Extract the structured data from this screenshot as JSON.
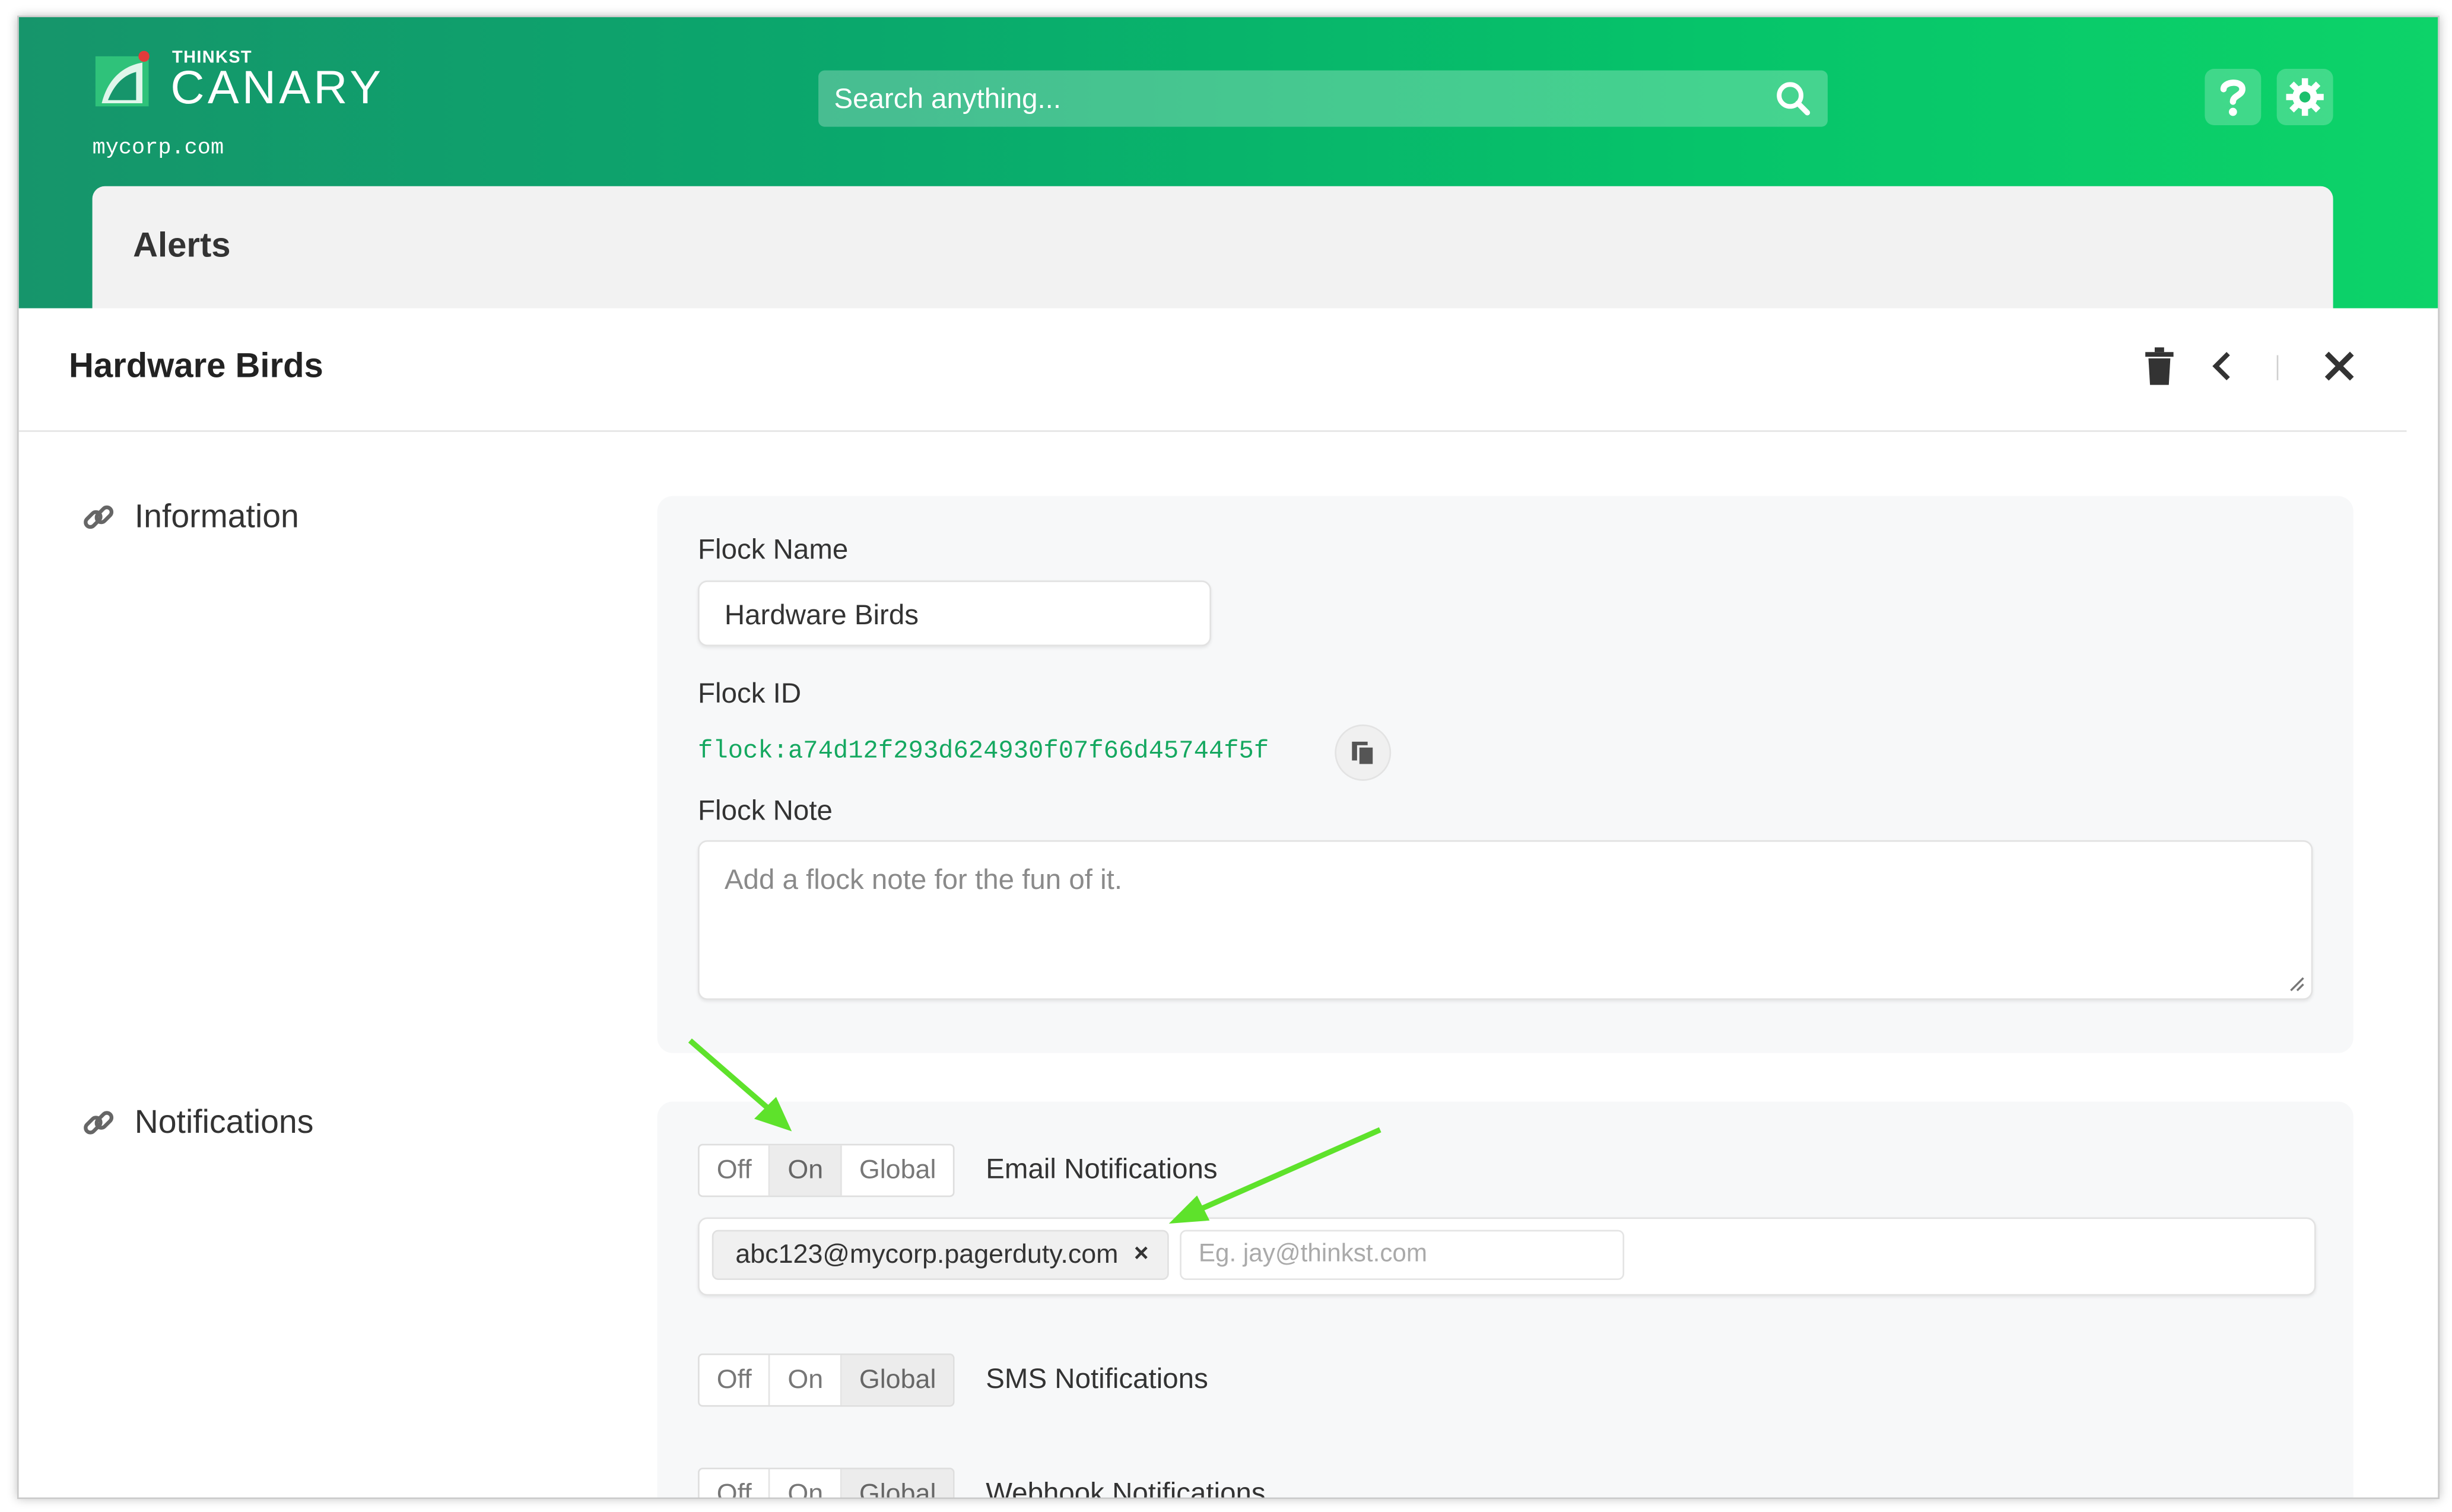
{
  "header": {
    "logo_small": "THINKST",
    "logo_big": "CANARY",
    "org": "mycorp.com",
    "search_placeholder": "Search anything...",
    "colors": {
      "band_start": "#16956b",
      "band_end": "#0dd369",
      "accent": "#15a860"
    }
  },
  "alerts": {
    "title": "Alerts"
  },
  "panel": {
    "title": "Hardware Birds"
  },
  "information": {
    "section_title": "Information",
    "flock_name_label": "Flock Name",
    "flock_name_value": "Hardware Birds",
    "flock_id_label": "Flock ID",
    "flock_id_value": "flock:a74d12f293d624930f07f66d45744f5f",
    "flock_note_label": "Flock Note",
    "flock_note_placeholder": "Add a flock note for the fun of it."
  },
  "notifications": {
    "section_title": "Notifications",
    "toggle_labels": [
      "Off",
      "On",
      "Global"
    ],
    "email": {
      "label": "Email Notifications",
      "selected": "On",
      "tag": "abc123@mycorp.pagerduty.com",
      "tag_remove": "×",
      "input_placeholder": "Eg. jay@thinkst.com"
    },
    "sms": {
      "label": "SMS Notifications",
      "selected": "Global"
    },
    "webhook": {
      "label": "Webhook Notifications",
      "selected": "Global"
    }
  },
  "icons": [
    "canary-logo-icon",
    "search-icon",
    "help-icon",
    "settings-gear-icon",
    "trash-icon",
    "chevron-left-icon",
    "close-icon",
    "link-icon",
    "copy-icon",
    "arrow-annotation"
  ]
}
